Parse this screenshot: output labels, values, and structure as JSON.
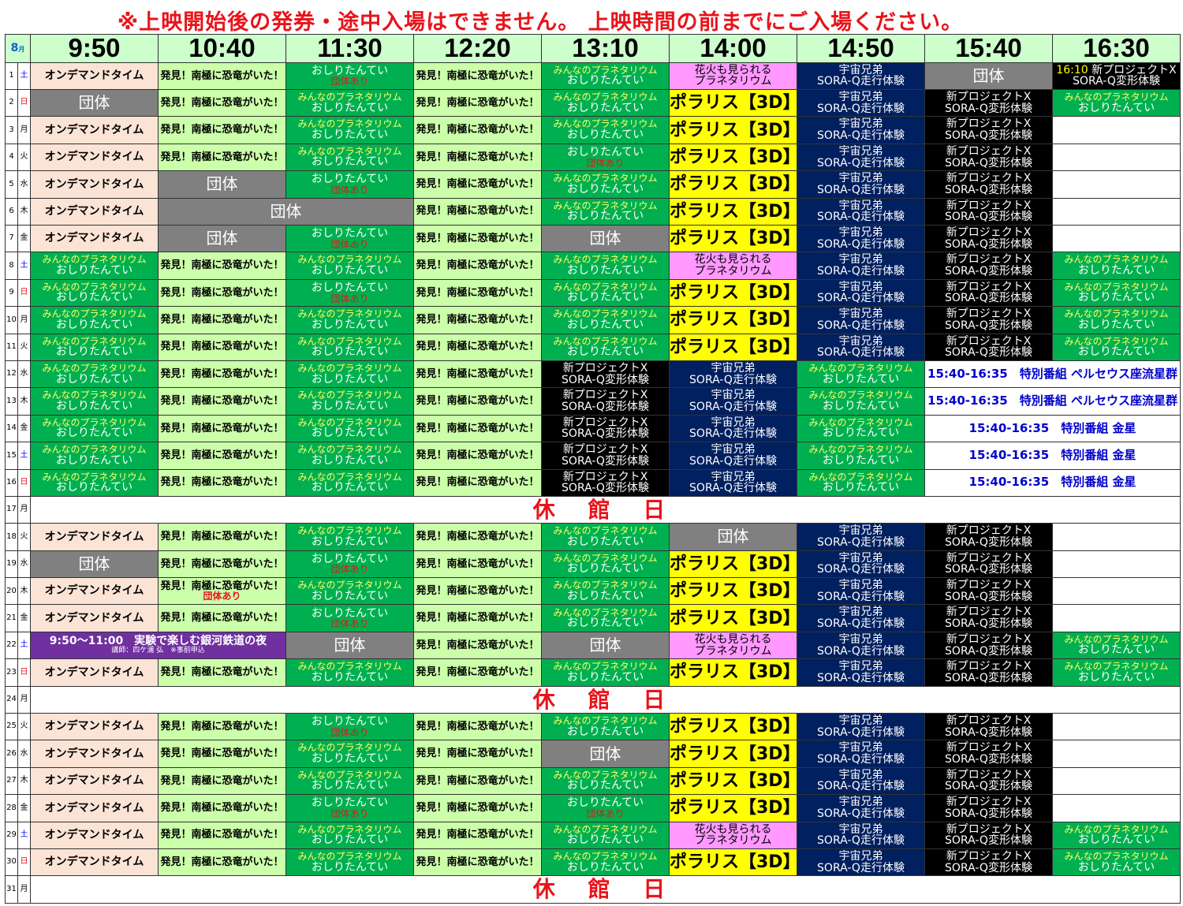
{
  "notice": "※上映開始後の発券・途中入場はできません。 上映時間の前までにご入場ください。",
  "month": {
    "num": "8",
    "unit": "月"
  },
  "times": [
    "9:50",
    "10:40",
    "11:30",
    "12:20",
    "13:10",
    "14:00",
    "14:50",
    "15:40",
    "16:30"
  ],
  "programs": {
    "ondemand": "オンデマンドタイム",
    "hakken": "発見！南極に恐竜がいた！",
    "minna": "みんなのプラネタリウム",
    "oshiri": "おしりたんてい",
    "dantai_ari": "団体あり",
    "dantai": "団体",
    "polaris": "ポラリス【3D】",
    "hanabi_1": "花火も見られる",
    "hanabi_2": "プラネタリウム",
    "uchu_1": "宇宙兄弟",
    "uchu_2": "SORA-Q走行体験",
    "proj_1": "新プロジェクトX",
    "proj_2": "SORA-Q変形体験",
    "proj_time": "16:10",
    "special_1": "15:40-16:35　特別番組 ペルセウス座流星群",
    "special_2": "15:40-16:35　特別番組 金星",
    "ginga_1": "9:50～11:00　実験で楽しむ銀河鉄道の夜",
    "ginga_2": "講師：四ケ浦 弘　※事前申込",
    "holiday": "休 館 日"
  },
  "days": [
    {
      "d": "1",
      "w": "土"
    },
    {
      "d": "2",
      "w": "日"
    },
    {
      "d": "3",
      "w": "月"
    },
    {
      "d": "4",
      "w": "火"
    },
    {
      "d": "5",
      "w": "水"
    },
    {
      "d": "6",
      "w": "木"
    },
    {
      "d": "7",
      "w": "金"
    },
    {
      "d": "8",
      "w": "土"
    },
    {
      "d": "9",
      "w": "日"
    },
    {
      "d": "10",
      "w": "月"
    },
    {
      "d": "11",
      "w": "火"
    },
    {
      "d": "12",
      "w": "水"
    },
    {
      "d": "13",
      "w": "木"
    },
    {
      "d": "14",
      "w": "金"
    },
    {
      "d": "15",
      "w": "土"
    },
    {
      "d": "16",
      "w": "日"
    },
    {
      "d": "17",
      "w": "月"
    },
    {
      "d": "18",
      "w": "火"
    },
    {
      "d": "19",
      "w": "水"
    },
    {
      "d": "20",
      "w": "木"
    },
    {
      "d": "21",
      "w": "金"
    },
    {
      "d": "22",
      "w": "土"
    },
    {
      "d": "23",
      "w": "日"
    },
    {
      "d": "24",
      "w": "月"
    },
    {
      "d": "25",
      "w": "火"
    },
    {
      "d": "26",
      "w": "水"
    },
    {
      "d": "27",
      "w": "木"
    },
    {
      "d": "28",
      "w": "金"
    },
    {
      "d": "29",
      "w": "土"
    },
    {
      "d": "30",
      "w": "日"
    },
    {
      "d": "31",
      "w": "月"
    }
  ],
  "schedule": [
    [
      [
        "OD",
        1
      ],
      [
        "HAK",
        1
      ],
      [
        "OSH_D",
        1
      ],
      [
        "HAK",
        1
      ],
      [
        "MIN",
        1
      ],
      [
        "HANA",
        1
      ],
      [
        "UCHU",
        1
      ],
      [
        "GRP",
        1
      ],
      [
        "PROJT",
        1
      ]
    ],
    [
      [
        "GRP",
        1
      ],
      [
        "HAK",
        1
      ],
      [
        "MIN",
        1
      ],
      [
        "HAK",
        1
      ],
      [
        "MIN",
        1
      ],
      [
        "POL",
        1
      ],
      [
        "UCHU",
        1
      ],
      [
        "PROJ",
        1
      ],
      [
        "MIN",
        1
      ]
    ],
    [
      [
        "OD",
        1
      ],
      [
        "HAK",
        1
      ],
      [
        "MIN",
        1
      ],
      [
        "HAK",
        1
      ],
      [
        "MIN",
        1
      ],
      [
        "POL",
        1
      ],
      [
        "UCHU",
        1
      ],
      [
        "PROJ",
        1
      ],
      [
        "BLANK",
        1
      ]
    ],
    [
      [
        "OD",
        1
      ],
      [
        "HAK",
        1
      ],
      [
        "MIN",
        1
      ],
      [
        "HAK",
        1
      ],
      [
        "OSH_D",
        1
      ],
      [
        "POL",
        1
      ],
      [
        "UCHU",
        1
      ],
      [
        "PROJ",
        1
      ],
      [
        "BLANK",
        1
      ]
    ],
    [
      [
        "OD",
        1
      ],
      [
        "GRP",
        1
      ],
      [
        "OSH_D",
        1
      ],
      [
        "HAK",
        1
      ],
      [
        "MIN",
        1
      ],
      [
        "POL",
        1
      ],
      [
        "UCHU",
        1
      ],
      [
        "PROJ",
        1
      ],
      [
        "BLANK",
        1
      ]
    ],
    [
      [
        "OD",
        1
      ],
      [
        "GRP",
        2
      ],
      [
        "HAK",
        1
      ],
      [
        "MIN",
        1
      ],
      [
        "POL",
        1
      ],
      [
        "UCHU",
        1
      ],
      [
        "PROJ",
        1
      ],
      [
        "BLANK",
        1
      ]
    ],
    [
      [
        "OD",
        1
      ],
      [
        "GRP",
        1
      ],
      [
        "OSH_D",
        1
      ],
      [
        "HAK",
        1
      ],
      [
        "GRP",
        1
      ],
      [
        "POL",
        1
      ],
      [
        "UCHU",
        1
      ],
      [
        "PROJ",
        1
      ],
      [
        "BLANK",
        1
      ]
    ],
    [
      [
        "MIN",
        1
      ],
      [
        "HAK",
        1
      ],
      [
        "MIN",
        1
      ],
      [
        "HAK",
        1
      ],
      [
        "MIN",
        1
      ],
      [
        "HANA",
        1
      ],
      [
        "UCHU",
        1
      ],
      [
        "PROJ",
        1
      ],
      [
        "MIN",
        1
      ]
    ],
    [
      [
        "MIN",
        1
      ],
      [
        "HAK",
        1
      ],
      [
        "OSH_D",
        1
      ],
      [
        "HAK",
        1
      ],
      [
        "MIN",
        1
      ],
      [
        "POL",
        1
      ],
      [
        "UCHU",
        1
      ],
      [
        "PROJ",
        1
      ],
      [
        "MIN",
        1
      ]
    ],
    [
      [
        "MIN",
        1
      ],
      [
        "HAK",
        1
      ],
      [
        "MIN",
        1
      ],
      [
        "HAK",
        1
      ],
      [
        "MIN",
        1
      ],
      [
        "POL",
        1
      ],
      [
        "UCHU",
        1
      ],
      [
        "PROJ",
        1
      ],
      [
        "MIN",
        1
      ]
    ],
    [
      [
        "MIN",
        1
      ],
      [
        "HAK",
        1
      ],
      [
        "MIN",
        1
      ],
      [
        "HAK",
        1
      ],
      [
        "MIN",
        1
      ],
      [
        "POL",
        1
      ],
      [
        "UCHU",
        1
      ],
      [
        "PROJ",
        1
      ],
      [
        "MIN",
        1
      ]
    ],
    [
      [
        "MIN",
        1
      ],
      [
        "HAK",
        1
      ],
      [
        "MIN",
        1
      ],
      [
        "HAK",
        1
      ],
      [
        "PROJ",
        1
      ],
      [
        "UCHU",
        1
      ],
      [
        "MIN",
        1
      ],
      [
        "SP1",
        2
      ]
    ],
    [
      [
        "MIN",
        1
      ],
      [
        "HAK",
        1
      ],
      [
        "MIN",
        1
      ],
      [
        "HAK",
        1
      ],
      [
        "PROJ",
        1
      ],
      [
        "UCHU",
        1
      ],
      [
        "MIN",
        1
      ],
      [
        "SP1",
        2
      ]
    ],
    [
      [
        "MIN",
        1
      ],
      [
        "HAK",
        1
      ],
      [
        "MIN",
        1
      ],
      [
        "HAK",
        1
      ],
      [
        "PROJ",
        1
      ],
      [
        "UCHU",
        1
      ],
      [
        "MIN",
        1
      ],
      [
        "SP2",
        2
      ]
    ],
    [
      [
        "MIN",
        1
      ],
      [
        "HAK",
        1
      ],
      [
        "MIN",
        1
      ],
      [
        "HAK",
        1
      ],
      [
        "PROJ",
        1
      ],
      [
        "UCHU",
        1
      ],
      [
        "MIN",
        1
      ],
      [
        "SP2",
        2
      ]
    ],
    [
      [
        "MIN",
        1
      ],
      [
        "HAK",
        1
      ],
      [
        "MIN",
        1
      ],
      [
        "HAK",
        1
      ],
      [
        "PROJ",
        1
      ],
      [
        "UCHU",
        1
      ],
      [
        "MIN",
        1
      ],
      [
        "SP2",
        2
      ]
    ],
    [
      [
        "HOL",
        9
      ]
    ],
    [
      [
        "OD",
        1
      ],
      [
        "HAK",
        1
      ],
      [
        "MIN",
        1
      ],
      [
        "HAK",
        1
      ],
      [
        "MIN",
        1
      ],
      [
        "GRP",
        1
      ],
      [
        "UCHU",
        1
      ],
      [
        "PROJ",
        1
      ],
      [
        "BLANK",
        1
      ]
    ],
    [
      [
        "GRP",
        1
      ],
      [
        "HAK",
        1
      ],
      [
        "OSH_D",
        1
      ],
      [
        "HAK",
        1
      ],
      [
        "MIN",
        1
      ],
      [
        "POL",
        1
      ],
      [
        "UCHU",
        1
      ],
      [
        "PROJ",
        1
      ],
      [
        "BLANK",
        1
      ]
    ],
    [
      [
        "OD",
        1
      ],
      [
        "HAK_D",
        1
      ],
      [
        "MIN",
        1
      ],
      [
        "HAK",
        1
      ],
      [
        "MIN",
        1
      ],
      [
        "POL",
        1
      ],
      [
        "UCHU",
        1
      ],
      [
        "PROJ",
        1
      ],
      [
        "BLANK",
        1
      ]
    ],
    [
      [
        "OD",
        1
      ],
      [
        "HAK",
        1
      ],
      [
        "OSH_D",
        1
      ],
      [
        "HAK",
        1
      ],
      [
        "MIN",
        1
      ],
      [
        "POL",
        1
      ],
      [
        "UCHU",
        1
      ],
      [
        "PROJ",
        1
      ],
      [
        "BLANK",
        1
      ]
    ],
    [
      [
        "GIN",
        2
      ],
      [
        "GRP",
        1
      ],
      [
        "HAK",
        1
      ],
      [
        "GRP",
        1
      ],
      [
        "HANA",
        1
      ],
      [
        "UCHU",
        1
      ],
      [
        "PROJ",
        1
      ],
      [
        "MIN",
        1
      ]
    ],
    [
      [
        "OD",
        1
      ],
      [
        "HAK",
        1
      ],
      [
        "MIN",
        1
      ],
      [
        "HAK",
        1
      ],
      [
        "MIN",
        1
      ],
      [
        "POL",
        1
      ],
      [
        "UCHU",
        1
      ],
      [
        "PROJ",
        1
      ],
      [
        "MIN",
        1
      ]
    ],
    [
      [
        "HOL",
        9
      ]
    ],
    [
      [
        "OD",
        1
      ],
      [
        "HAK",
        1
      ],
      [
        "OSH_D",
        1
      ],
      [
        "HAK",
        1
      ],
      [
        "MIN",
        1
      ],
      [
        "POL",
        1
      ],
      [
        "UCHU",
        1
      ],
      [
        "PROJ",
        1
      ],
      [
        "BLANK",
        1
      ]
    ],
    [
      [
        "OD",
        1
      ],
      [
        "HAK",
        1
      ],
      [
        "MIN",
        1
      ],
      [
        "HAK",
        1
      ],
      [
        "GRP",
        1
      ],
      [
        "POL",
        1
      ],
      [
        "UCHU",
        1
      ],
      [
        "PROJ",
        1
      ],
      [
        "BLANK",
        1
      ]
    ],
    [
      [
        "OD",
        1
      ],
      [
        "HAK",
        1
      ],
      [
        "MIN",
        1
      ],
      [
        "HAK",
        1
      ],
      [
        "MIN",
        1
      ],
      [
        "POL",
        1
      ],
      [
        "UCHU",
        1
      ],
      [
        "PROJ",
        1
      ],
      [
        "BLANK",
        1
      ]
    ],
    [
      [
        "OD",
        1
      ],
      [
        "HAK",
        1
      ],
      [
        "OSH_D",
        1
      ],
      [
        "HAK",
        1
      ],
      [
        "OSH_D",
        1
      ],
      [
        "POL",
        1
      ],
      [
        "UCHU",
        1
      ],
      [
        "PROJ",
        1
      ],
      [
        "BLANK",
        1
      ]
    ],
    [
      [
        "OD",
        1
      ],
      [
        "HAK",
        1
      ],
      [
        "MIN",
        1
      ],
      [
        "HAK",
        1
      ],
      [
        "MIN",
        1
      ],
      [
        "HANA",
        1
      ],
      [
        "UCHU",
        1
      ],
      [
        "PROJ",
        1
      ],
      [
        "MIN",
        1
      ]
    ],
    [
      [
        "OD",
        1
      ],
      [
        "HAK",
        1
      ],
      [
        "MIN",
        1
      ],
      [
        "HAK",
        1
      ],
      [
        "MIN",
        1
      ],
      [
        "POL",
        1
      ],
      [
        "UCHU",
        1
      ],
      [
        "PROJ",
        1
      ],
      [
        "MIN",
        1
      ]
    ],
    [
      [
        "HOL",
        9
      ]
    ]
  ],
  "colors": {
    "weekday": "#000000",
    "saturday": "#0000ff",
    "sunday": "#e8141b",
    "notice": "#e8141b"
  }
}
